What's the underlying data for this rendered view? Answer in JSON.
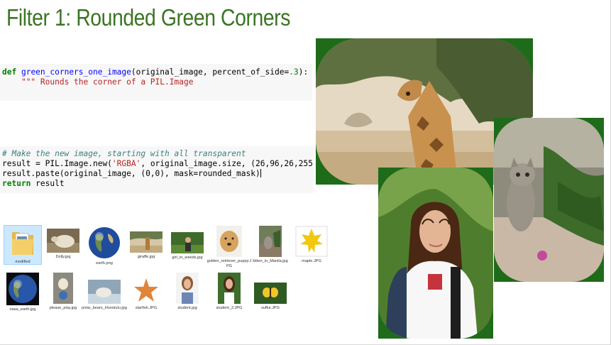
{
  "slide": {
    "title": "Filter 1: Rounded Green Corners"
  },
  "code_cell_1": {
    "line1_kw": "def",
    "line1_fn": "green_corners_one_image",
    "line1_args_a": "(original_image, percent_of_side=",
    "line1_num": ".3",
    "line1_args_b": "):",
    "line2_indent": "    ",
    "line2_doc": "\"\"\" Rounds the corner of a PIL.Image"
  },
  "code_cell_2": {
    "comment": "# Make the new image, starting with all transparent",
    "line2_a": "result = PIL.Image.new(",
    "line2_str": "'RGBA'",
    "line2_b": ", original_image.size, (26,96,26,255))",
    "line3": "result.paste(original_image, (0,0), mask=rounded_mask)",
    "line4_kw": "return",
    "line4_rest": " result"
  },
  "files": [
    {
      "name": "modified",
      "icon": "folder-icon"
    },
    {
      "name": "Dolly.jpg",
      "icon": "image-thumbnail"
    },
    {
      "name": "earth.png",
      "icon": "image-thumbnail"
    },
    {
      "name": "giraffe.jpg",
      "icon": "image-thumbnail"
    },
    {
      "name": "girl_in_weeds.jpg",
      "icon": "image-thumbnail"
    },
    {
      "name": "golden_retriever_puppy.JPG",
      "icon": "image-thumbnail"
    },
    {
      "name": "kitten_in_Manila.jpg",
      "icon": "image-thumbnail"
    },
    {
      "name": "maple.JPG",
      "icon": "image-thumbnail"
    },
    {
      "name": "nasa_earth.jpg",
      "icon": "image-thumbnail"
    },
    {
      "name": "please_play.jpg",
      "icon": "image-thumbnail"
    },
    {
      "name": "polar_bears_Honolulu.jpg",
      "icon": "image-thumbnail"
    },
    {
      "name": "starfish.JPG",
      "icon": "image-thumbnail"
    },
    {
      "name": "student.jpg",
      "icon": "image-thumbnail"
    },
    {
      "name": "student_2.JPG",
      "icon": "image-thumbnail"
    },
    {
      "name": "suffur.JPG",
      "icon": "image-thumbnail"
    }
  ],
  "colors": {
    "title": "#3b7523",
    "frame_green": "#1e6b19",
    "code_bg": "#f7f7f7"
  }
}
